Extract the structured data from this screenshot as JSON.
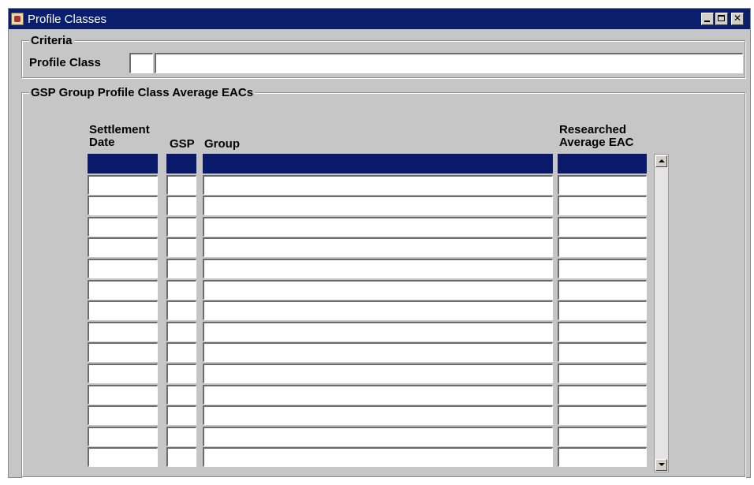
{
  "window": {
    "title": "Profile Classes",
    "controls": [
      "minimize",
      "maximize",
      "close"
    ]
  },
  "criteria": {
    "group_label": "Criteria",
    "profile_class_label": "Profile Class",
    "profile_class_code": "",
    "profile_class_description": ""
  },
  "eac_group": {
    "group_label": "GSP Group Profile Class Average EACs",
    "columns": {
      "settlement_date": "Settlement\nDate",
      "gsp_group": "GSP",
      "gsp_group_name": "Group",
      "researched_eac": "Researched\nAverage EAC"
    },
    "row_count": 15,
    "selected_row": 1,
    "rows": [
      {
        "settlement_date": "",
        "gsp_group": "",
        "gsp_group_name": "",
        "researched_eac": ""
      },
      {
        "settlement_date": "",
        "gsp_group": "",
        "gsp_group_name": "",
        "researched_eac": ""
      },
      {
        "settlement_date": "",
        "gsp_group": "",
        "gsp_group_name": "",
        "researched_eac": ""
      },
      {
        "settlement_date": "",
        "gsp_group": "",
        "gsp_group_name": "",
        "researched_eac": ""
      },
      {
        "settlement_date": "",
        "gsp_group": "",
        "gsp_group_name": "",
        "researched_eac": ""
      },
      {
        "settlement_date": "",
        "gsp_group": "",
        "gsp_group_name": "",
        "researched_eac": ""
      },
      {
        "settlement_date": "",
        "gsp_group": "",
        "gsp_group_name": "",
        "researched_eac": ""
      },
      {
        "settlement_date": "",
        "gsp_group": "",
        "gsp_group_name": "",
        "researched_eac": ""
      },
      {
        "settlement_date": "",
        "gsp_group": "",
        "gsp_group_name": "",
        "researched_eac": ""
      },
      {
        "settlement_date": "",
        "gsp_group": "",
        "gsp_group_name": "",
        "researched_eac": ""
      },
      {
        "settlement_date": "",
        "gsp_group": "",
        "gsp_group_name": "",
        "researched_eac": ""
      },
      {
        "settlement_date": "",
        "gsp_group": "",
        "gsp_group_name": "",
        "researched_eac": ""
      },
      {
        "settlement_date": "",
        "gsp_group": "",
        "gsp_group_name": "",
        "researched_eac": ""
      },
      {
        "settlement_date": "",
        "gsp_group": "",
        "gsp_group_name": "",
        "researched_eac": ""
      },
      {
        "settlement_date": "",
        "gsp_group": "",
        "gsp_group_name": "",
        "researched_eac": ""
      }
    ]
  },
  "colors": {
    "title_bar": "#0a1e6e",
    "selection": "#0a1a6a",
    "window_bg": "#c6c6c6"
  }
}
